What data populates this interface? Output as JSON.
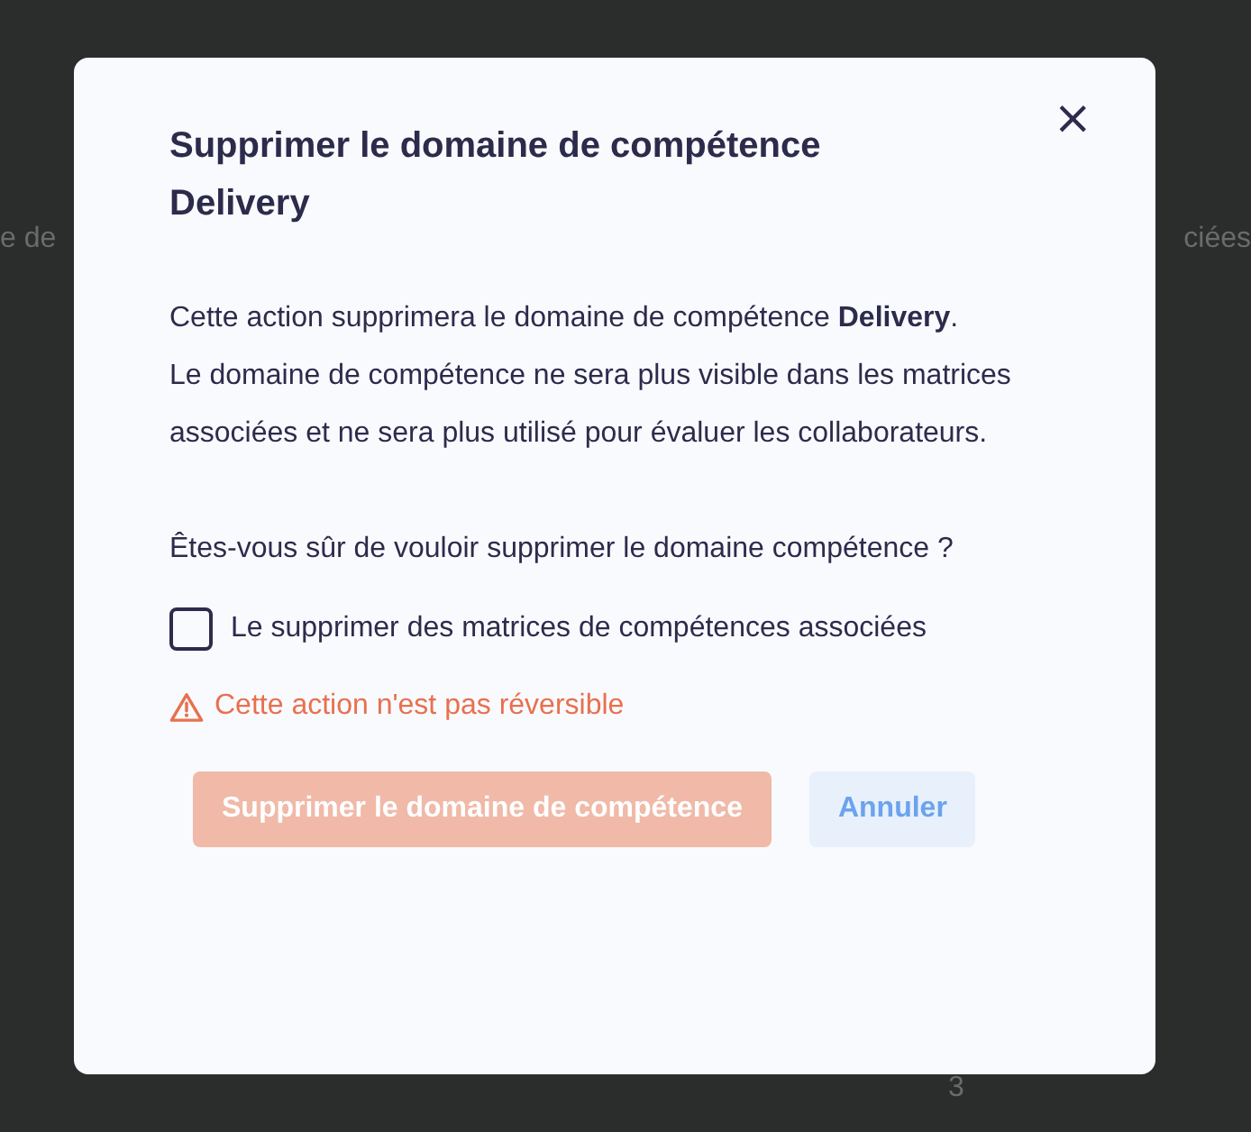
{
  "background": {
    "left_text": "e de",
    "right_text": "ciées",
    "bottom_text": "3"
  },
  "dialog": {
    "title": "Supprimer le domaine de compétence Delivery",
    "close": "×",
    "paragraphs": [
      "Cette action supprimera le domaine de compétence **Delivery**.",
      "Le domaine de compétence ne sera plus visible dans les matrices associées et ne sera plus utilisé pour évaluer les collaborateurs."
    ],
    "question": "Êtes-vous sûr de vouloir supprimer le domaine compétence ?",
    "checkbox": {
      "label": "Le supprimer des matrices de compétences associées",
      "checked": false
    },
    "warning": "Cette action n'est pas réversible",
    "buttons": [
      {
        "label": "Supprimer le domaine de compétence",
        "kind": "danger",
        "disabled": true
      },
      {
        "label": "Annuler",
        "kind": "secondary",
        "disabled": false
      }
    ]
  }
}
